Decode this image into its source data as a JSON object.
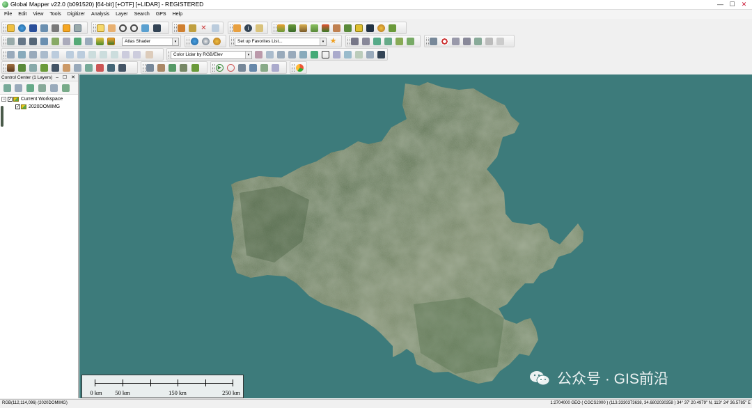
{
  "window": {
    "title": "Global Mapper v22.0 (b091520) [64-bit] [+OTF] [+LIDAR] - REGISTERED",
    "min_glyph": "—",
    "max_glyph": "☐",
    "close_glyph": "✕"
  },
  "menu": [
    "File",
    "Edit",
    "View",
    "Tools",
    "Digitizer",
    "Analysis",
    "Layer",
    "Search",
    "GPS",
    "Help"
  ],
  "toolbar": {
    "shader_select": "Atlas Shader",
    "favorites_select": "Set up Favorites List...",
    "lidar_color_select": "Color Lidar by RGB/Elev",
    "dropdown_glyph": "▾"
  },
  "control_center": {
    "title": "Control Center (1 Layers)",
    "buttons_glyph": "– ☐ ✕",
    "tree": {
      "workspace": "Current Workspace",
      "layer": "2020DOMIMG",
      "expander": "−",
      "check": "✓"
    }
  },
  "scale_bar": {
    "labels": [
      "0 km",
      "50 km",
      "150 km",
      "250 km"
    ]
  },
  "watermark": "公众号 · GIS前沿",
  "status": {
    "left": "RGB(112,114,096) (2020DOMIMG)",
    "right": "1:2704000  GEO ( CGCS2000 ) (113.3330373638, 34.6802030358 ) 34° 37' 20.4979\" N, 113° 24' 36.5785\" E"
  },
  "colors": {
    "map_background": "#3d7b7b",
    "imagery_dark": "#4f6a48",
    "imagery_light": "#7a8f6e"
  }
}
